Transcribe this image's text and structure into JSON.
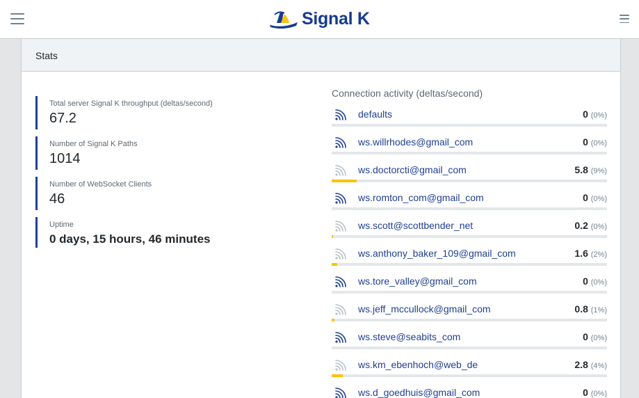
{
  "header": {
    "brand": "Signal K",
    "logo_icon": "signalk-logo-icon",
    "left_menu_icon": "hamburger-icon",
    "right_menu_icon": "hamburger-icon"
  },
  "card": {
    "title": "Stats"
  },
  "stats": [
    {
      "label": "Total server Signal K throughput (deltas/second)",
      "value": "67.2"
    },
    {
      "label": "Number of Signal K Paths",
      "value": "1014"
    },
    {
      "label": "Number of WebSocket Clients",
      "value": "46"
    },
    {
      "label": "Uptime",
      "value": "0 days, 15 hours, 46 minutes"
    }
  ],
  "connections": {
    "title": "Connection activity (deltas/second)",
    "accent_color": "#ffc107",
    "link_color": "#1f3f93",
    "items": [
      {
        "name": "defaults",
        "value": "0",
        "pct": "(0%)",
        "fill": 0.0,
        "active": true
      },
      {
        "name": "ws.willrhodes@gmail_com",
        "value": "0",
        "pct": "(0%)",
        "fill": 0.0,
        "active": true
      },
      {
        "name": "ws.doctorcti@gmail_com",
        "value": "5.8",
        "pct": "(9%)",
        "fill": 0.09,
        "active": false
      },
      {
        "name": "ws.romton_com@gmail_com",
        "value": "0",
        "pct": "(0%)",
        "fill": 0.0,
        "active": true
      },
      {
        "name": "ws.scott@scottbender_net",
        "value": "0.2",
        "pct": "(0%)",
        "fill": 0.004,
        "active": false
      },
      {
        "name": "ws.anthony_baker_109@gmail_com",
        "value": "1.6",
        "pct": "(2%)",
        "fill": 0.02,
        "active": false
      },
      {
        "name": "ws.tore_valley@gmail_com",
        "value": "0",
        "pct": "(0%)",
        "fill": 0.0,
        "active": true
      },
      {
        "name": "ws.jeff_mccullock@gmail_com",
        "value": "0.8",
        "pct": "(1%)",
        "fill": 0.01,
        "active": false
      },
      {
        "name": "ws.steve@seabits_com",
        "value": "0",
        "pct": "(0%)",
        "fill": 0.0,
        "active": true
      },
      {
        "name": "ws.km_ebenhoch@web_de",
        "value": "2.8",
        "pct": "(4%)",
        "fill": 0.04,
        "active": false
      },
      {
        "name": "ws.d_goedhuis@gmail_com",
        "value": "0",
        "pct": "(0%)",
        "fill": 0.0,
        "active": true
      }
    ]
  }
}
